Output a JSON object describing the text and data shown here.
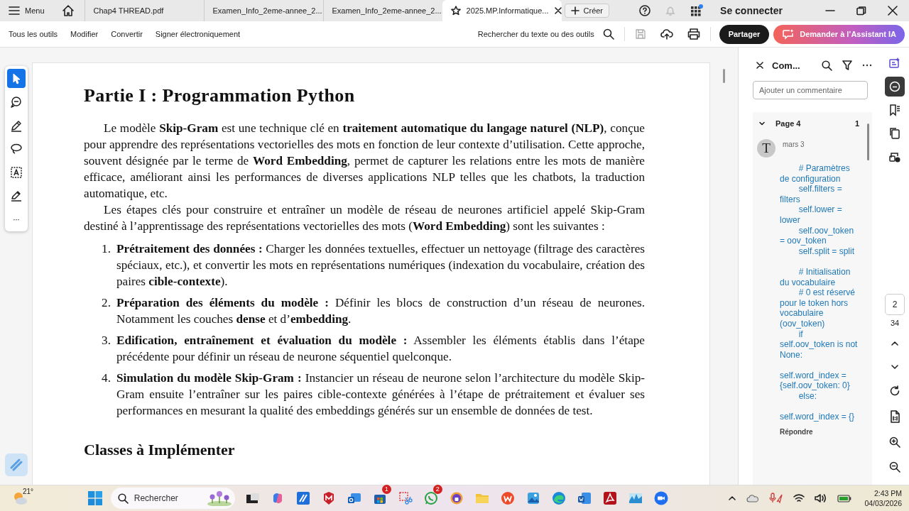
{
  "tab_bar": {
    "menu": "Menu",
    "tabs": [
      {
        "title": "Chap4 THREAD.pdf",
        "selected": false
      },
      {
        "title": "Examen_Info_2eme-annee_2...",
        "selected": false
      },
      {
        "title": "Examen_Info_2eme-annee_2...",
        "selected": false
      },
      {
        "title": "2025.MP.Informatique...",
        "selected": true
      }
    ],
    "create": "Créer",
    "sign_in": "Se connecter"
  },
  "toolbar": {
    "menus": [
      "Tous les outils",
      "Modifier",
      "Convertir",
      "Signer électroniquement"
    ],
    "search": "Rechercher du texte ou des outils",
    "share": "Partager",
    "assistant": "Demander à l’Assistant IA"
  },
  "tools": [
    {
      "kind": "select",
      "selected": true
    },
    {
      "kind": "comment",
      "selected": false
    },
    {
      "kind": "pen",
      "selected": false
    },
    {
      "kind": "lasso",
      "selected": false
    },
    {
      "kind": "text",
      "selected": false
    },
    {
      "kind": "sign",
      "selected": false
    },
    {
      "kind": "more",
      "label": "···",
      "selected": false
    }
  ],
  "document": {
    "heading": "Partie I : Programmation Python",
    "paragraphs": [
      "Le modèle **Skip-Gram** est une technique clé en **traitement automatique du langage naturel (NLP)**, conçue pour apprendre des représentations vectorielles des mots en fonction de leur contexte d’utilisation. Cette approche, souvent désignée par le terme de **Word Embedding**, permet de capturer les relations entre les mots de manière efficace, améliorant ainsi les performances de diverses applications NLP telles que les chatbots, la traduction automatique, etc.",
      "Les étapes clés pour construire et entraîner un modèle de réseau de neurones artificiel appelé Skip-Gram destiné à l’apprentissage des représentations vectorielles des mots (**Word Embedding**) sont les suivantes :"
    ],
    "steps": [
      {
        "number": "1.",
        "text": "**Prétraitement des données :** Charger les données textuelles, effectuer un nettoyage (filtrage des caractères spéciaux, etc.), et convertir les mots en représentations numériques (indexation du vocabulaire, création des paires **cible-contexte**)."
      },
      {
        "number": "2.",
        "text": "**Préparation des éléments du modèle :** Définir les blocs de construction d’un réseau de neurones. Notamment les couches **dense** et d’**embedding**."
      },
      {
        "number": "3.",
        "text": "**Edification, entraînement et évaluation du modèle :** Assembler les éléments établis dans l’étape précédente pour définir un réseau de neurone séquentiel quelconque."
      },
      {
        "number": "4.",
        "text": "**Simulation du modèle Skip-Gram :** Instancier un réseau de neurone selon l’architecture du modèle Skip-Gram ensuite l’entraîner sur les paires cible-contexte générées à l’étape de prétraitement et évaluer ses performances en mesurant la qualité des embeddings générés sur un ensemble de données de test."
      }
    ],
    "next_heading": "Classes à Implémenter"
  },
  "comments_panel": {
    "title": "Com...",
    "placeholder": "Ajouter un commentaire",
    "group": {
      "label": "Page 4",
      "count": "1",
      "expanded": true
    },
    "comment": {
      "avatar": "T",
      "date": "mars 3",
      "body": "        # Paramètres de configuration\n        self.filters = filters\n        self.lower = lower\n        self.oov_token = oov_token\n        self.split = split\n\n        # Initialisation du vocabulaire\n        # 0 est réservé pour le token hors vocabulaire (oov_token)\n        if self.oov_token is not None:\n                    self.word_index = {self.oov_token: 0}\n        else:\n                    self.word_index = {}",
      "reply": "Répondre"
    }
  },
  "right_rail": [
    {
      "kind": "edit-page",
      "selected": false
    },
    {
      "kind": "comments",
      "selected": true
    },
    {
      "kind": "bookmarks",
      "selected": false
    },
    {
      "kind": "pages",
      "selected": false
    },
    {
      "kind": "protect",
      "selected": false
    }
  ],
  "page_nav": {
    "current": "2",
    "total": "34"
  },
  "taskbar": {
    "weather": "21°",
    "search": "Rechercher",
    "apps": [
      {
        "kind": "terminal"
      },
      {
        "kind": "copilot"
      },
      {
        "kind": "pen-app"
      },
      {
        "kind": "shield"
      },
      {
        "kind": "mail"
      },
      {
        "kind": "store",
        "badge": "1"
      },
      {
        "kind": "snip"
      },
      {
        "kind": "chat",
        "badge": "2"
      },
      {
        "kind": "vpn"
      },
      {
        "kind": "folder"
      },
      {
        "kind": "wps"
      },
      {
        "kind": "photos"
      },
      {
        "kind": "edge"
      },
      {
        "kind": "word"
      },
      {
        "kind": "acrobat"
      },
      {
        "kind": "chart-app"
      },
      {
        "kind": "zoom"
      }
    ],
    "time": "2:43 PM",
    "date": "04/03/2026"
  }
}
